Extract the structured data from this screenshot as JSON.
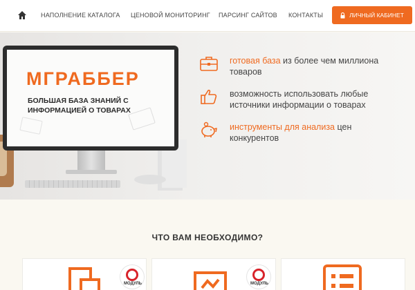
{
  "nav": {
    "links": [
      "НАПОЛНЕНИЕ КАТАЛОГА",
      "ЦЕНОВОЙ МОНИТОРИНГ",
      "ПАРСИНГ САЙТОВ",
      "КОНТАКТЫ"
    ],
    "cabinet_label": "ЛИЧНЫЙ КАБИНЕТ"
  },
  "hero": {
    "brand": "МГРАББЕР",
    "subtitle": "БОЛЬШАЯ БАЗА ЗНАНИЙ С ИНФОРМАЦИЕЙ О ТОВАРАХ",
    "features": [
      {
        "icon": "briefcase-icon",
        "highlight": "готовая база",
        "text": " из более чем миллиона товаров"
      },
      {
        "icon": "thumbs-up-icon",
        "highlight": "",
        "text": "возможность использовать любые источники информации о товарах"
      },
      {
        "icon": "piggy-bank-icon",
        "highlight": "инструменты для анализа",
        "text": " цен конкурентов"
      }
    ]
  },
  "section": {
    "title": "ЧТО ВАМ НЕОБХОДИМО?",
    "badge_text": "МОДУЛЬ"
  },
  "colors": {
    "accent": "#ef6a20",
    "badge_red": "#d8232a"
  }
}
